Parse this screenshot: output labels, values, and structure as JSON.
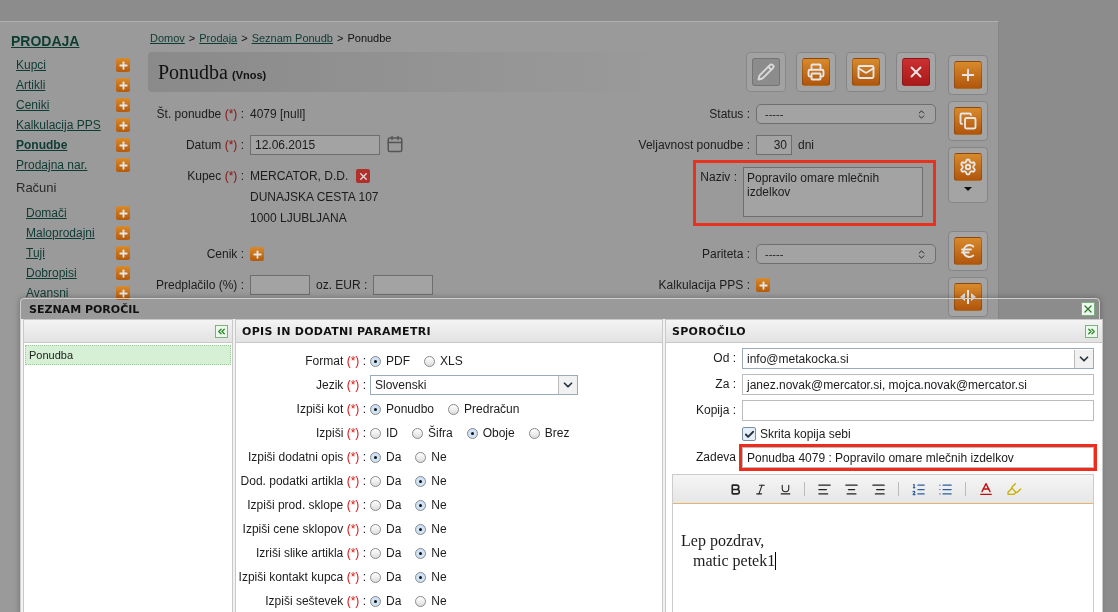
{
  "sidebar": {
    "title": "PRODAJA",
    "items": [
      {
        "label": "Kupci",
        "selected": false
      },
      {
        "label": "Artikli",
        "selected": false
      },
      {
        "label": "Ceniki",
        "selected": false
      },
      {
        "label": "Kalkulacija PPS",
        "selected": false
      },
      {
        "label": "Ponudbe",
        "selected": true
      },
      {
        "label": "Prodajna nar.",
        "selected": false
      }
    ],
    "group": {
      "label": "Računi",
      "items": [
        {
          "label": "Domači",
          "selected": false
        },
        {
          "label": "Maloprodajni",
          "selected": false
        },
        {
          "label": "Tuji",
          "selected": false
        },
        {
          "label": "Dobropisi",
          "selected": false
        },
        {
          "label": "Avansni",
          "selected": false
        }
      ]
    }
  },
  "breadcrumb": [
    {
      "label": "Domov",
      "link": true
    },
    {
      "label": "Prodaja",
      "link": true
    },
    {
      "label": "Seznam Ponudb",
      "link": true
    },
    {
      "label": "Ponudbe",
      "link": false
    }
  ],
  "breadcrumb_separator": ">",
  "header": {
    "title": "Ponudba",
    "subtitle": "(Vnos)"
  },
  "toolbar": [
    {
      "kind": "edit",
      "disabled": true
    },
    {
      "kind": "print",
      "disabled": false
    },
    {
      "kind": "mail",
      "disabled": false
    },
    {
      "kind": "delete",
      "disabled": false
    }
  ],
  "side_toolbar": [
    {
      "kind": "add"
    },
    {
      "kind": "copy"
    },
    {
      "kind": "settings_menu"
    },
    {
      "kind": "euro"
    },
    {
      "kind": "split"
    }
  ],
  "form": {
    "rows": [
      {
        "left": {
          "label": "Št. ponudbe",
          "mark": "(*)",
          "colon": ":",
          "kind": "text",
          "value": "4079 [null]"
        },
        "right": {
          "label": "Status :",
          "kind": "select",
          "value": "-----"
        }
      },
      {
        "left": {
          "label": "Datum",
          "mark": "(*)",
          "colon": ":",
          "kind": "date",
          "value": "12.06.2015"
        },
        "right": {
          "label": "Veljavnost ponudbe :",
          "kind": "input",
          "value": "30",
          "unit": "dni"
        }
      },
      {
        "left": {
          "label": "Kupec",
          "mark": "(*)",
          "colon": ":",
          "kind": "customer",
          "lines": [
            "MERCATOR, D.D.",
            "DUNAJSKA CESTA 107",
            "1000 LJUBLJANA"
          ]
        },
        "right": {
          "label": "Naziv :",
          "kind": "textarea",
          "value": "Popravilo omare mlečnih izdelkov",
          "highlighted": true
        }
      },
      {
        "left": {
          "label": "Cenik :",
          "kind": "add"
        },
        "right": {
          "label": "Pariteta :",
          "kind": "select",
          "value": "-----"
        }
      },
      {
        "left": {
          "label": "Predplačilo (%) :",
          "kind": "input_pair",
          "second_label": "oz. EUR :"
        },
        "right": {
          "label": "Kalkulacija PPS :",
          "kind": "add"
        }
      }
    ]
  },
  "dialog": {
    "title": "SEZNAM POROČIL",
    "reports": [
      {
        "label": "Ponudba",
        "selected": true
      }
    ],
    "params": {
      "title": "OPIS IN DODATNI PARAMETRI",
      "rows": [
        {
          "label": "Format",
          "mark": "(*)",
          "colon": ":",
          "kind": "radio",
          "options": [
            {
              "label": "PDF",
              "selected": true
            },
            {
              "label": "XLS",
              "selected": false
            }
          ]
        },
        {
          "label": "Jezik",
          "mark": "(*)",
          "colon": ":",
          "kind": "select",
          "value": "Slovenski"
        },
        {
          "label": "Izpiši kot",
          "mark": "(*)",
          "colon": ":",
          "kind": "radio",
          "options": [
            {
              "label": "Ponudbo",
              "selected": true
            },
            {
              "label": "Predračun",
              "selected": false
            }
          ]
        },
        {
          "label": "Izpiši",
          "mark": "(*)",
          "colon": ":",
          "kind": "radio",
          "options": [
            {
              "label": "ID",
              "selected": false
            },
            {
              "label": "Šifra",
              "selected": false
            },
            {
              "label": "Oboje",
              "selected": true
            },
            {
              "label": "Brez",
              "selected": false
            }
          ]
        },
        {
          "label": "Izpiši dodatni opis",
          "mark": "(*)",
          "colon": ":",
          "kind": "radio",
          "options": [
            {
              "label": "Da",
              "selected": true
            },
            {
              "label": "Ne",
              "selected": false
            }
          ]
        },
        {
          "label": "Dod. podatki artikla",
          "mark": "(*)",
          "colon": ":",
          "kind": "radio",
          "options": [
            {
              "label": "Da",
              "selected": false
            },
            {
              "label": "Ne",
              "selected": true
            }
          ]
        },
        {
          "label": "Izpiši prod. sklope",
          "mark": "(*)",
          "colon": ":",
          "kind": "radio",
          "options": [
            {
              "label": "Da",
              "selected": false
            },
            {
              "label": "Ne",
              "selected": true
            }
          ]
        },
        {
          "label": "Izpiši cene sklopov",
          "mark": "(*)",
          "colon": ":",
          "kind": "radio",
          "options": [
            {
              "label": "Da",
              "selected": false
            },
            {
              "label": "Ne",
              "selected": true
            }
          ]
        },
        {
          "label": "Izriši slike artikla",
          "mark": "(*)",
          "colon": ":",
          "kind": "radio",
          "options": [
            {
              "label": "Da",
              "selected": false
            },
            {
              "label": "Ne",
              "selected": true
            }
          ]
        },
        {
          "label": "Izpiši kontakt kupca",
          "mark": "(*)",
          "colon": ":",
          "kind": "radio",
          "options": [
            {
              "label": "Da",
              "selected": false
            },
            {
              "label": "Ne",
              "selected": true
            }
          ]
        },
        {
          "label": "Izpiši seštevek",
          "mark": "(*)",
          "colon": ":",
          "kind": "radio",
          "options": [
            {
              "label": "Da",
              "selected": true
            },
            {
              "label": "Ne",
              "selected": false
            }
          ]
        }
      ]
    },
    "message": {
      "title": "SPOROČILO",
      "fields": [
        {
          "label": "Od :",
          "kind": "select",
          "value": "info@metakocka.si"
        },
        {
          "label": "Za :",
          "kind": "input",
          "value": "janez.novak@mercator.si, mojca.novak@mercator.si"
        },
        {
          "label": "Kopija :",
          "kind": "input"
        },
        {
          "kind": "checkbox",
          "text": "Skrita kopija sebi",
          "checked": true
        },
        {
          "label": "Zadeva",
          "kind": "input",
          "value": "Ponudba 4079 : Popravilo omare mlečnih izdelkov",
          "highlighted": true
        }
      ],
      "body": [
        "Lep pozdrav,",
        "matic petek1"
      ]
    }
  }
}
